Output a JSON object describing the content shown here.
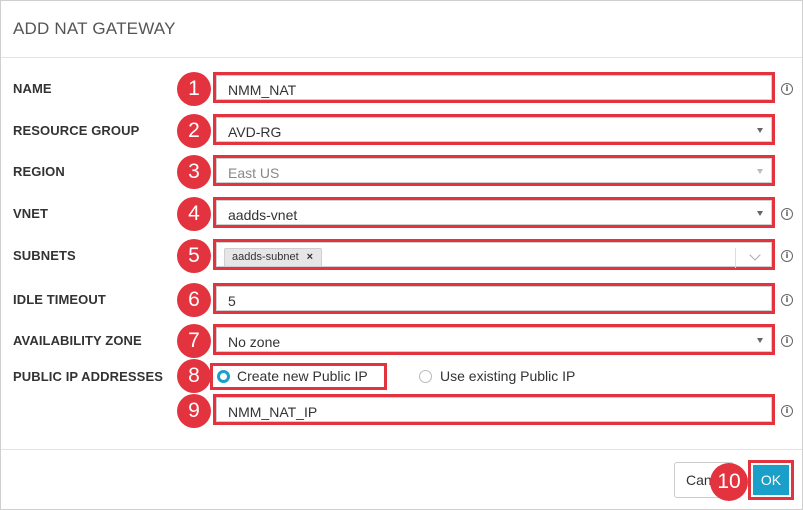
{
  "dialog": {
    "title": "ADD NAT GATEWAY"
  },
  "form": {
    "name": {
      "label": "NAME",
      "value": "NMM_NAT",
      "badge": "1"
    },
    "resource_group": {
      "label": "RESOURCE GROUP",
      "value": "AVD-RG",
      "badge": "2"
    },
    "region": {
      "label": "REGION",
      "value": "East US",
      "badge": "3"
    },
    "vnet": {
      "label": "VNET",
      "value": "aadds-vnet",
      "badge": "4"
    },
    "subnets": {
      "label": "SUBNETS",
      "chip": "aadds-subnet",
      "chip_remove": "×",
      "badge": "5"
    },
    "idle_timeout": {
      "label": "IDLE TIMEOUT",
      "value": "5",
      "badge": "6"
    },
    "availability_zone": {
      "label": "AVAILABILITY ZONE",
      "value": "No zone",
      "badge": "7"
    },
    "public_ip": {
      "label": "PUBLIC IP ADDRESSES",
      "badge": "8",
      "option_new": "Create new Public IP",
      "option_existing": "Use existing Public IP",
      "selected": "option_new"
    },
    "public_ip_name": {
      "value": "NMM_NAT_IP",
      "badge": "9"
    }
  },
  "info_glyph": "i",
  "footer": {
    "cancel_label": "Cancel",
    "ok_label": "OK",
    "badge": "10"
  },
  "colors": {
    "highlight": "#e3333f",
    "accent": "#1aa0c8"
  }
}
